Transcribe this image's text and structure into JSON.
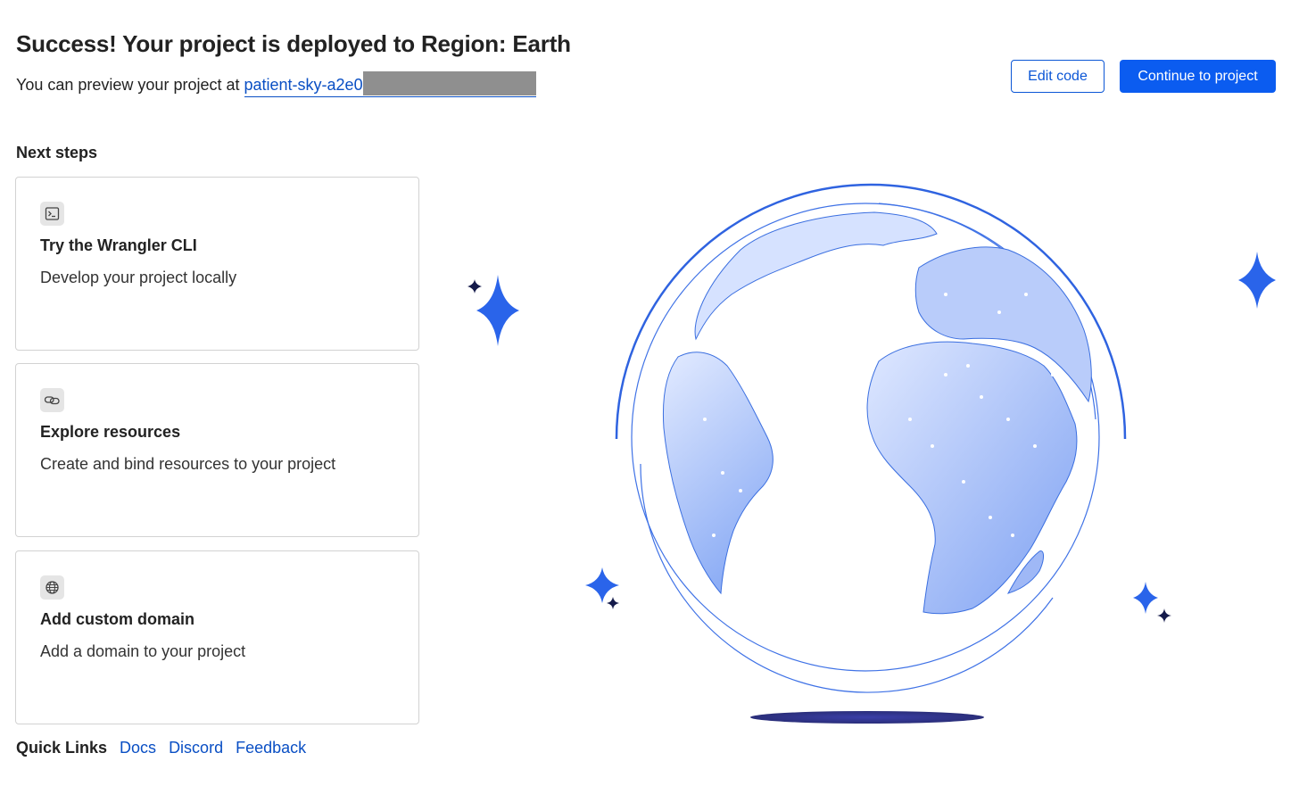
{
  "header": {
    "title": "Success! Your project is deployed to Region: Earth",
    "preview_prefix": "You can preview your project at",
    "preview_link": "patient-sky-a2e0"
  },
  "actions": {
    "edit_code": "Edit code",
    "continue": "Continue to project"
  },
  "next_steps": {
    "heading": "Next steps",
    "cards": [
      {
        "icon": "terminal-icon",
        "title": "Try the Wrangler CLI",
        "description": "Develop your project locally"
      },
      {
        "icon": "link-icon",
        "title": "Explore resources",
        "description": "Create and bind resources to your project"
      },
      {
        "icon": "globe-icon",
        "title": "Add custom domain",
        "description": "Add a domain to your project"
      }
    ]
  },
  "quick_links": {
    "label": "Quick Links",
    "links": [
      "Docs",
      "Discord",
      "Feedback"
    ]
  },
  "colors": {
    "primary": "#0b5cf0",
    "link": "#0a4fc4",
    "globe_blue": "#3b6fe0",
    "sparkle_dark": "#141a4a",
    "shadow": "#3a3f9a"
  }
}
